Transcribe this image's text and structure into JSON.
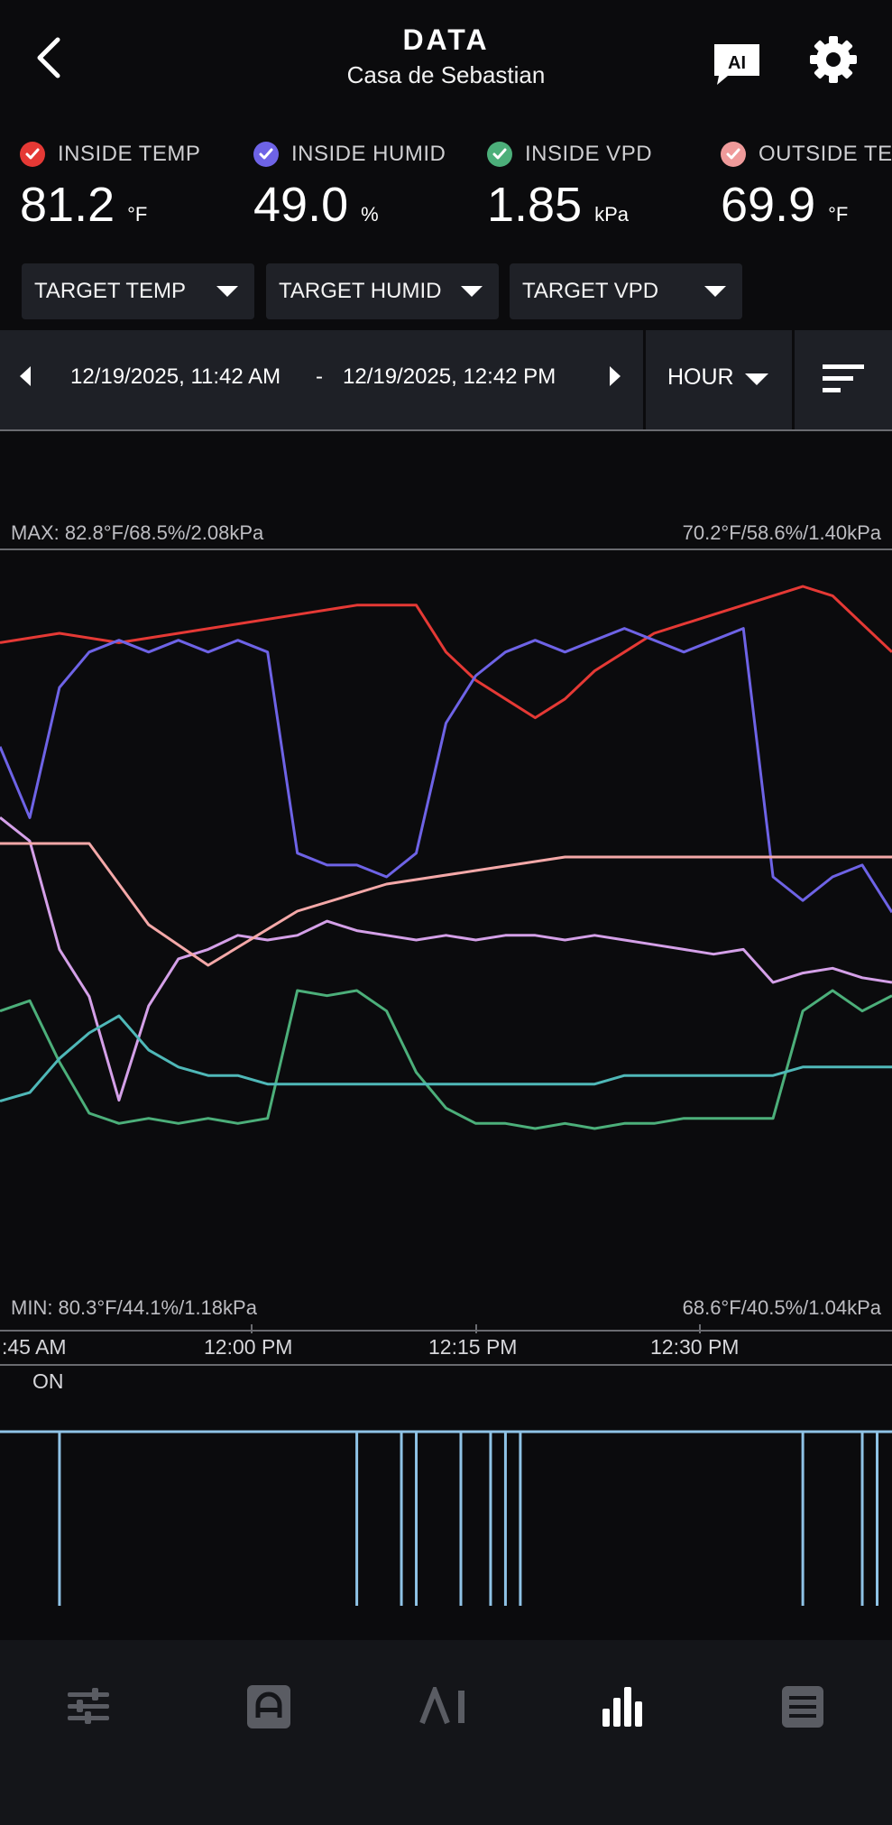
{
  "header": {
    "title": "DATA",
    "subtitle": "Casa de Sebastian",
    "ai_label": "AI"
  },
  "readings": [
    {
      "label": "INSIDE TEMP",
      "value": "81.2",
      "unit": "°F",
      "color": "#e53935"
    },
    {
      "label": "INSIDE HUMID",
      "value": "49.0",
      "unit": "%",
      "color": "#6e63e6"
    },
    {
      "label": "INSIDE VPD",
      "value": "1.85",
      "unit": "kPa",
      "color": "#4caf7a"
    },
    {
      "label": "OUTSIDE TE",
      "value": "69.9",
      "unit": "°F",
      "color": "#ef9a9a"
    }
  ],
  "targets": [
    "TARGET TEMP",
    "TARGET HUMID",
    "TARGET VPD"
  ],
  "date_range": {
    "start": "12/19/2025, 11:42 AM",
    "separator": "-",
    "end": "12/19/2025, 12:42 PM",
    "interval": "HOUR"
  },
  "chart_labels": {
    "max_inside": "MAX: 82.8°F/68.5%/2.08kPa",
    "max_outside": "70.2°F/58.6%/1.40kPa",
    "min_inside": "MIN:  80.3°F/44.1%/1.18kPa",
    "min_outside": "68.6°F/40.5%/1.04kPa"
  },
  "time_ticks": [
    ":45 AM",
    "12:00 PM",
    "12:15 PM",
    "12:30 PM"
  ],
  "event_state_label": "ON",
  "chart_data": {
    "type": "line",
    "x_range": [
      "11:42 AM",
      "12:42 PM"
    ],
    "series": [
      {
        "color": "#e53935",
        "x": [
          0,
          4,
          8,
          12,
          16,
          20,
          24,
          28,
          30,
          32,
          34,
          36,
          38,
          40,
          42,
          44,
          46,
          48,
          50,
          52,
          54,
          56,
          58,
          60
        ],
        "y": [
          82.2,
          82.3,
          82.2,
          82.3,
          82.4,
          82.5,
          82.6,
          82.6,
          82.1,
          81.8,
          81.6,
          81.4,
          81.6,
          81.9,
          82.1,
          82.3,
          82.4,
          82.5,
          82.6,
          82.7,
          82.8,
          82.7,
          82.4,
          82.1
        ]
      },
      {
        "color": "#6e63e6",
        "x": [
          0,
          2,
          4,
          6,
          8,
          10,
          12,
          14,
          16,
          18,
          20,
          22,
          24,
          26,
          28,
          30,
          32,
          34,
          36,
          38,
          40,
          42,
          44,
          46,
          48,
          50,
          52,
          54,
          56,
          58,
          60
        ],
        "y": [
          58,
          52,
          63,
          66,
          67,
          66,
          67,
          66,
          67,
          66,
          49,
          48,
          48,
          47,
          49,
          60,
          64,
          66,
          67,
          66,
          67,
          68,
          67,
          66,
          67,
          68,
          47,
          45,
          47,
          48,
          44
        ]
      },
      {
        "color": "#d4a0e8",
        "x": [
          0,
          2,
          4,
          6,
          8,
          10,
          12,
          14,
          16,
          18,
          20,
          22,
          24,
          26,
          28,
          30,
          32,
          34,
          36,
          38,
          40,
          42,
          44,
          46,
          48,
          50,
          52,
          54,
          56,
          58,
          60
        ],
        "y": [
          1.8,
          1.75,
          1.52,
          1.42,
          1.2,
          1.4,
          1.5,
          1.52,
          1.55,
          1.54,
          1.55,
          1.58,
          1.56,
          1.55,
          1.54,
          1.55,
          1.54,
          1.55,
          1.55,
          1.54,
          1.55,
          1.54,
          1.53,
          1.52,
          1.51,
          1.52,
          1.45,
          1.47,
          1.48,
          1.46,
          1.45
        ]
      },
      {
        "color": "#f4a8a8",
        "x": [
          0,
          6,
          10,
          14,
          20,
          26,
          32,
          38,
          44,
          50,
          56,
          60
        ],
        "y": [
          69.9,
          69.9,
          69.3,
          69.0,
          69.4,
          69.6,
          69.7,
          69.8,
          69.8,
          69.8,
          69.8,
          69.8
        ]
      },
      {
        "color": "#4caf7a",
        "x": [
          0,
          2,
          4,
          6,
          8,
          10,
          12,
          14,
          16,
          18,
          20,
          22,
          24,
          26,
          28,
          30,
          32,
          34,
          36,
          38,
          40,
          42,
          44,
          46,
          48,
          50,
          52,
          54,
          56,
          58,
          60
        ],
        "y": [
          1.62,
          1.64,
          1.52,
          1.42,
          1.4,
          1.41,
          1.4,
          1.41,
          1.4,
          1.41,
          1.66,
          1.65,
          1.66,
          1.62,
          1.5,
          1.43,
          1.4,
          1.4,
          1.39,
          1.4,
          1.39,
          1.4,
          1.4,
          1.41,
          1.41,
          1.41,
          1.41,
          1.62,
          1.66,
          1.62,
          1.65
        ]
      },
      {
        "color": "#4fb8b8",
        "x": [
          0,
          2,
          4,
          6,
          8,
          10,
          12,
          14,
          16,
          18,
          20,
          22,
          24,
          26,
          28,
          30,
          32,
          34,
          36,
          38,
          40,
          42,
          44,
          46,
          48,
          50,
          52,
          54,
          56,
          58,
          60
        ],
        "y": [
          1.05,
          1.06,
          1.1,
          1.13,
          1.15,
          1.11,
          1.09,
          1.08,
          1.08,
          1.07,
          1.07,
          1.07,
          1.07,
          1.07,
          1.07,
          1.07,
          1.07,
          1.07,
          1.07,
          1.07,
          1.07,
          1.08,
          1.08,
          1.08,
          1.08,
          1.08,
          1.08,
          1.09,
          1.09,
          1.09,
          1.09
        ]
      }
    ],
    "events": {
      "state": "ON",
      "x": [
        4,
        24,
        27,
        28,
        31,
        33,
        34,
        35,
        54,
        58,
        59
      ],
      "color": "#8fc3e6"
    }
  },
  "bottom_nav": [
    {
      "name": "controls-tab",
      "icon": "sliders-icon"
    },
    {
      "name": "automation-tab",
      "icon": "automation-icon"
    },
    {
      "name": "ai-tab",
      "icon": "ai-icon",
      "label": "AI"
    },
    {
      "name": "data-tab",
      "icon": "bar-chart-icon"
    },
    {
      "name": "log-tab",
      "icon": "list-icon"
    }
  ]
}
